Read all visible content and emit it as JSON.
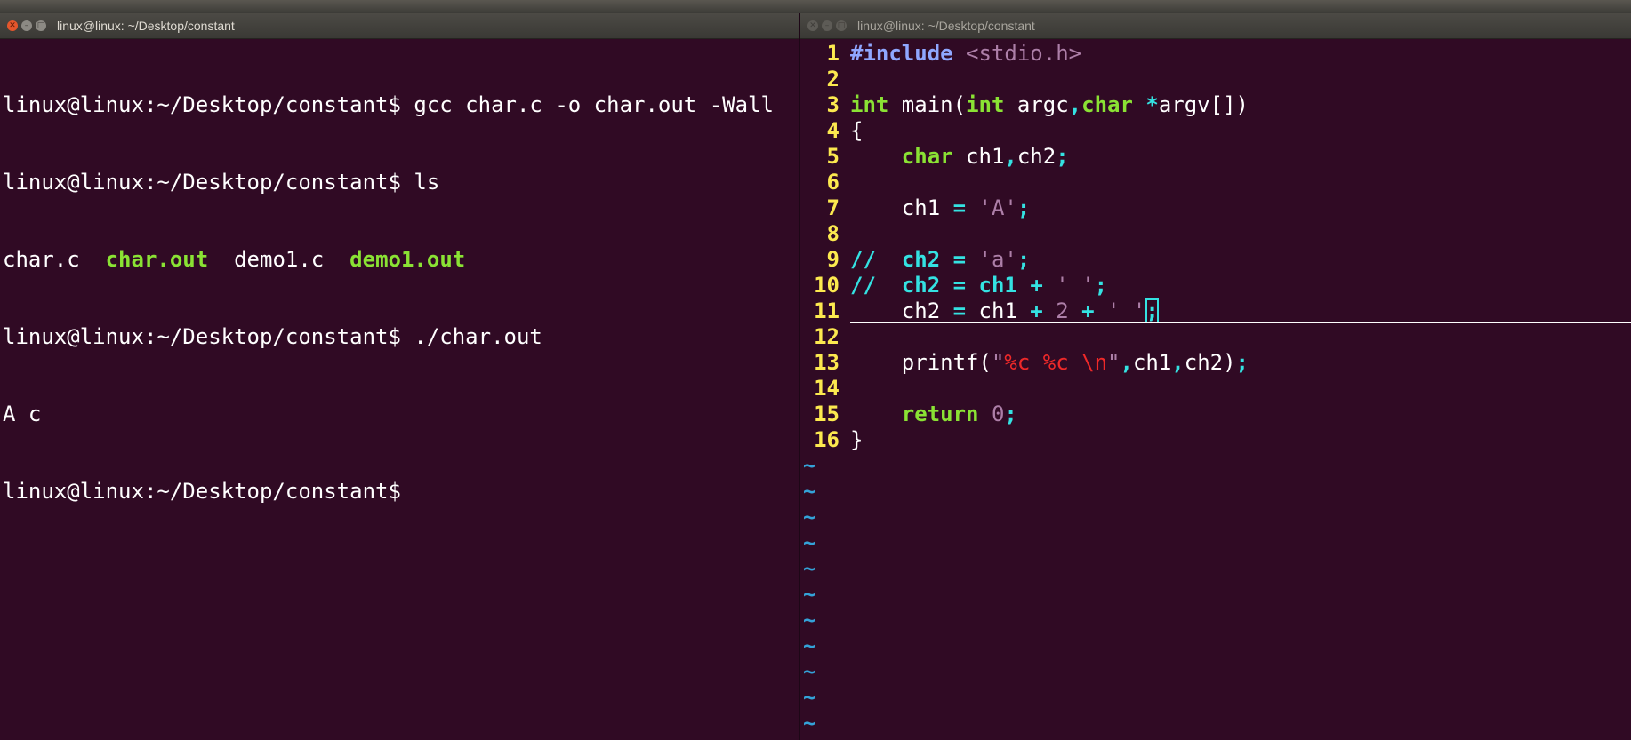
{
  "left_window": {
    "title": "linux@linux: ~/Desktop/constant",
    "lines": [
      "linux@linux:~/Desktop/constant$ gcc char.c -o char.out -Wall",
      "linux@linux:~/Desktop/constant$ ls",
      "",
      "linux@linux:~/Desktop/constant$ ./char.out",
      "A c",
      "linux@linux:~/Desktop/constant$"
    ],
    "ls_output": [
      {
        "name": "char.c",
        "type": "file"
      },
      {
        "name": "char.out",
        "type": "executable"
      },
      {
        "name": "demo1.c",
        "type": "file"
      },
      {
        "name": "demo1.out",
        "type": "executable"
      }
    ]
  },
  "right_window": {
    "title": "linux@linux: ~/Desktop/constant",
    "line_numbers": [
      "1",
      "2",
      "3",
      "4",
      "5",
      "6",
      "7",
      "8",
      "9",
      "10",
      "11",
      "12",
      "13",
      "14",
      "15",
      "16"
    ],
    "code": [
      "#include <stdio.h>",
      "",
      "int main(int argc,char *argv[])",
      "{",
      "    char ch1,ch2;",
      "",
      "    ch1 = 'A';",
      "",
      "//  ch2 = 'a';",
      "//  ch2 = ch1 + ' ';",
      "    ch2 = ch1 + 2 + ' ';",
      "",
      "    printf(\"%c %c \\n\",ch1,ch2);",
      "",
      "    return 0;",
      "}"
    ],
    "tilde_marker": "~",
    "tilde_count": 11
  },
  "colors": {
    "background": "#300a24",
    "executable": "#8ae234",
    "line_number": "#fce94f",
    "tilde": "#34a2d8",
    "keyword": "#8ae234",
    "operator": "#34e2e2",
    "string": "#ad7fa8",
    "format": "#ef2929"
  }
}
